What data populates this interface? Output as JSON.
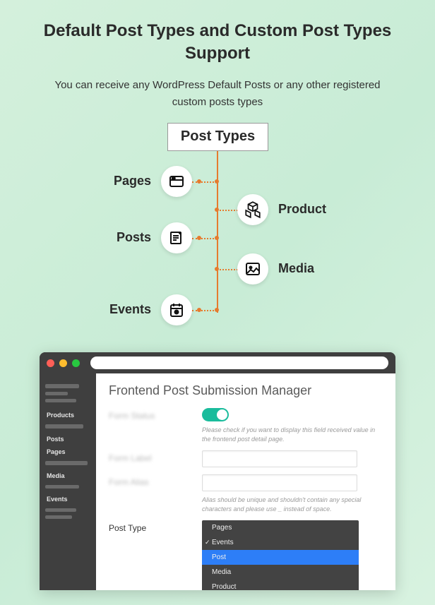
{
  "heading": "Default Post Types and Custom Post Types Support",
  "subheading": "You can receive any WordPress Default Posts or any other registered custom posts types",
  "diagram": {
    "box_label": "Post Types",
    "nodes": {
      "pages": "Pages",
      "product": "Product",
      "posts": "Posts",
      "media": "Media",
      "events": "Events"
    }
  },
  "app": {
    "title": "Frontend Post Submission Manager",
    "sidebar": {
      "items": [
        "Products",
        "Posts",
        "Pages",
        "Media",
        "Events"
      ]
    },
    "form": {
      "status_label": "Form Status",
      "status_help": "Please check if you want to display this field received value in the frontend post detail page.",
      "label_label": "Form Label",
      "alias_label": "Form Alias",
      "alias_help": "Alias should be unique and shouldn't contain any special characters and please use _ instead of space.",
      "posttype_label": "Post Type",
      "dropdown": [
        "Pages",
        "Events",
        "Post",
        "Media",
        "Product"
      ],
      "dropdown_checked": "Events",
      "dropdown_selected": "Post"
    }
  }
}
